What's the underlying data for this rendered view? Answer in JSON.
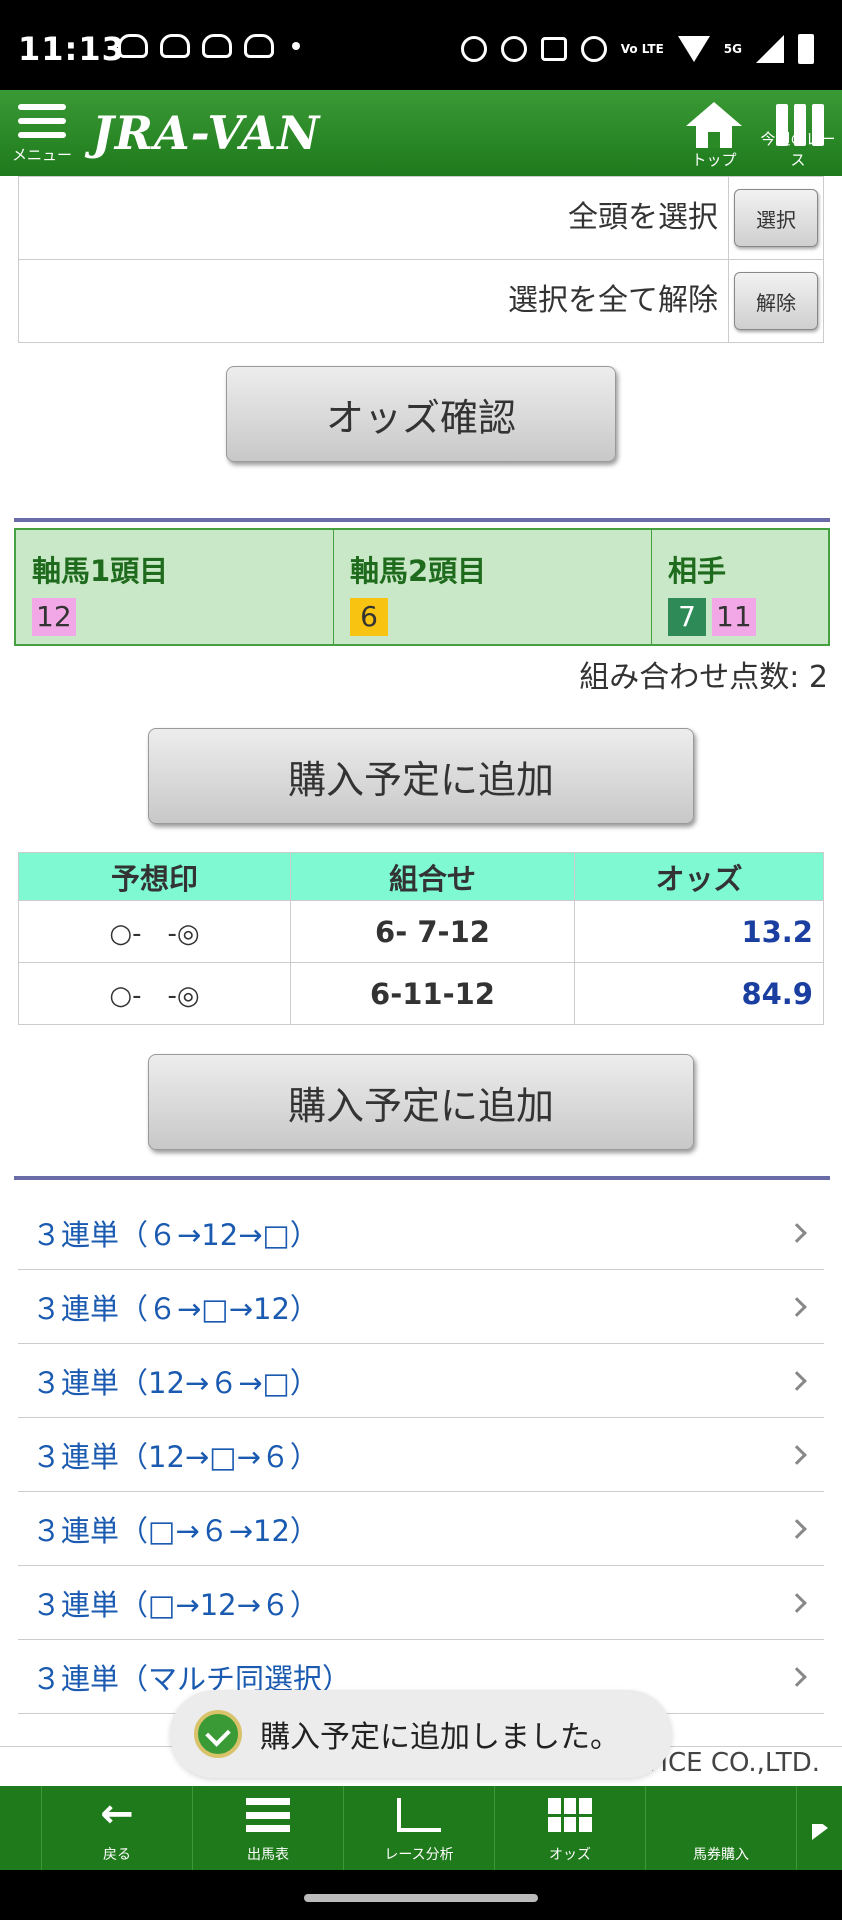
{
  "status_bar": {
    "time": "11:13",
    "network": "5G",
    "volte": "Vo LTE"
  },
  "header": {
    "menu_label": "メニュー",
    "logo": "JRA-VAN",
    "top_label": "トップ",
    "this_week_label": "今週のレース"
  },
  "selection": {
    "select_all_label": "全頭を選択",
    "select_all_button": "選択",
    "clear_all_label": "選択を全て解除",
    "clear_all_button": "解除"
  },
  "odds_check_button": "オッズ確認",
  "axis": {
    "first_title": "軸馬1頭目",
    "first_horses": [
      "12"
    ],
    "second_title": "軸馬2頭目",
    "second_horses": [
      "6"
    ],
    "partner_title": "相手",
    "partner_horses": [
      "7",
      "11"
    ],
    "colors": {
      "pink": "#f2a7e6",
      "yellow": "#f8c311",
      "green": "#2e8b57"
    }
  },
  "combination_count": "組み合わせ点数: 2",
  "add_to_plan_button": "購入予定に追加",
  "odds_table": {
    "headers": [
      "予想印",
      "組合せ",
      "オッズ"
    ],
    "rows": [
      {
        "mark": "○-　-◎",
        "combo": "6- 7-12",
        "odds": "13.2"
      },
      {
        "mark": "○-　-◎",
        "combo": "6-11-12",
        "odds": "84.9"
      }
    ]
  },
  "bet_links": [
    "３連単（６→12→□）",
    "３連単（６→□→12）",
    "３連単（12→６→□）",
    "３連単（12→□→６）",
    "３連単（□→６→12）",
    "３連単（□→12→６）",
    "３連単（マルチ同選択）"
  ],
  "copyright_fragment": "VICE CO.,LTD.",
  "toast": {
    "message": "購入予定に追加しました。"
  },
  "bottom_nav": [
    {
      "label": "戻る",
      "icon": "back-arrow-icon"
    },
    {
      "label": "出馬表",
      "icon": "list-icon"
    },
    {
      "label": "レース分析",
      "icon": "chart-icon"
    },
    {
      "label": "オッズ",
      "icon": "odds-grid-icon"
    },
    {
      "label": "馬券購入",
      "icon": "ticket-icon"
    }
  ]
}
